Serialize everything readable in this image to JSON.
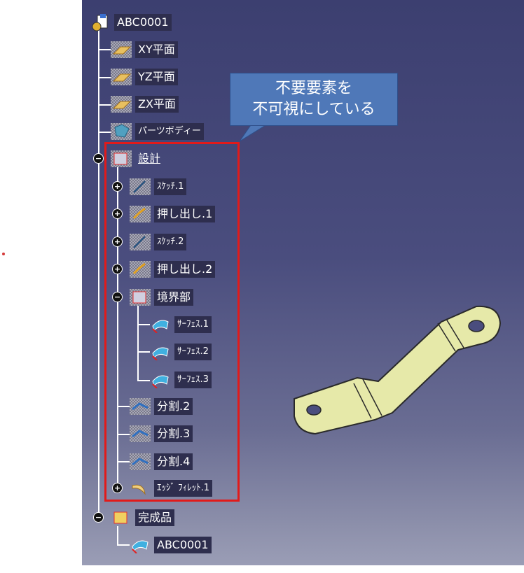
{
  "root": {
    "label": "ABC0001"
  },
  "planes": [
    {
      "label": "XY平面"
    },
    {
      "label": "YZ平面"
    },
    {
      "label": "ZX平面"
    }
  ],
  "parts_body": {
    "label": "パーツボディー"
  },
  "design": {
    "label": "設計",
    "items": [
      {
        "label": "ｽｹｯﾁ.1"
      },
      {
        "label": "押し出し.1"
      },
      {
        "label": "ｽｹｯﾁ.2"
      },
      {
        "label": "押し出し.2"
      }
    ],
    "boundary": {
      "label": "境界部",
      "surfaces": [
        {
          "label": "ｻｰﾌｪｽ.1"
        },
        {
          "label": "ｻｰﾌｪｽ.2"
        },
        {
          "label": "ｻｰﾌｪｽ.3"
        }
      ]
    },
    "splits": [
      {
        "label": "分割.2"
      },
      {
        "label": "分割.3"
      },
      {
        "label": "分割.4"
      }
    ],
    "fillet": {
      "label": "ｴｯｼﾞ ﾌｨﾚｯﾄ.1"
    }
  },
  "finished": {
    "label": "完成品",
    "items": [
      {
        "label": "ABC0001"
      }
    ]
  },
  "callout": {
    "line1": "不要要素を",
    "line2": "不可視にしている"
  },
  "colors": {
    "highlight_box": "#e21a1a",
    "callout_fill": "#4f78b8",
    "part_fill": "#e6e9a9"
  }
}
